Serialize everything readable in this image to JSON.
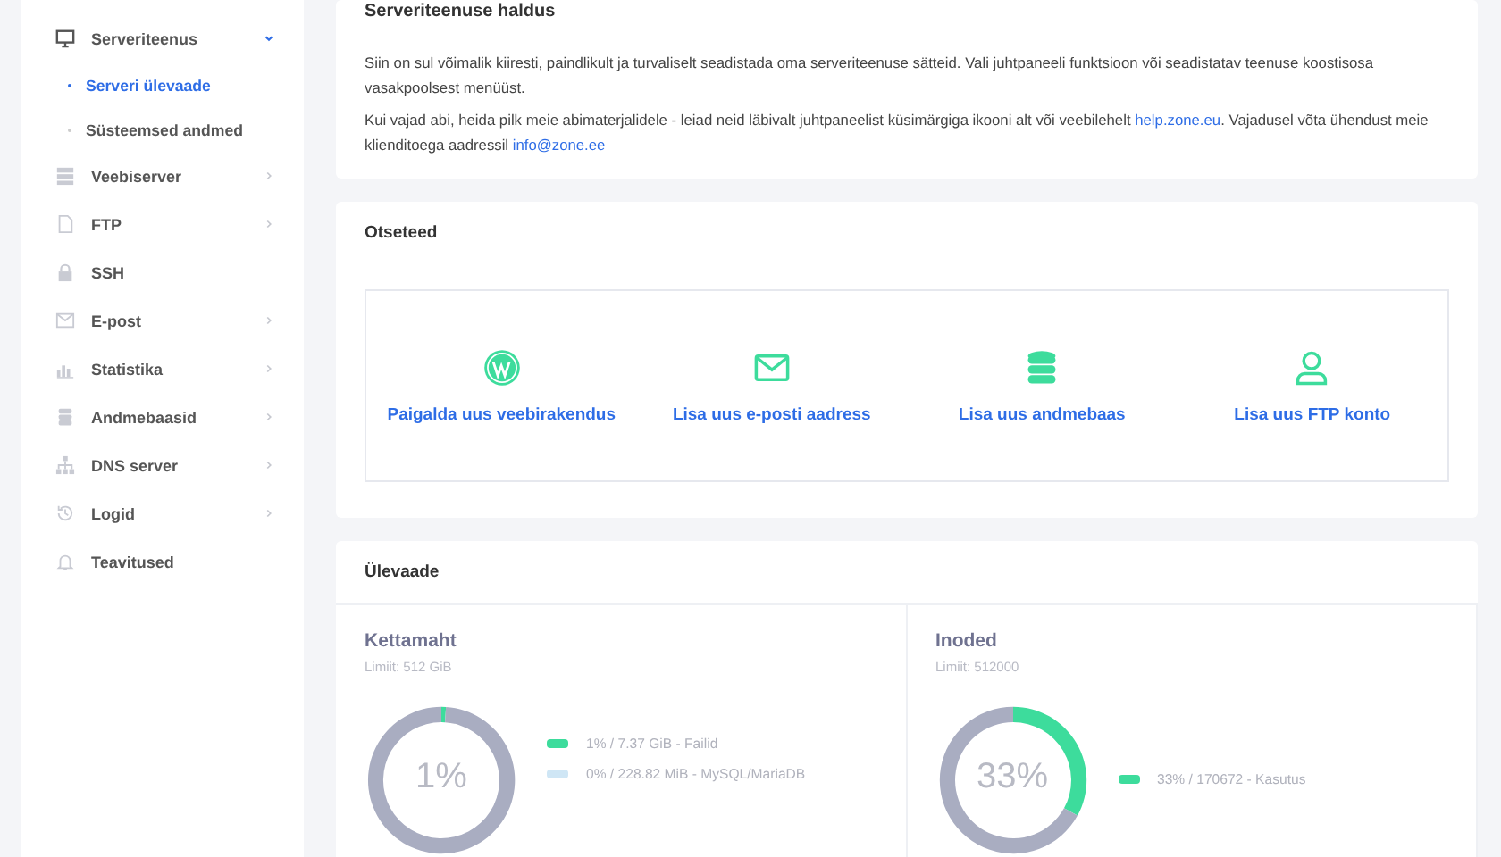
{
  "sidebar": {
    "items": [
      {
        "label": "Serveriteenus",
        "expanded": true,
        "children": [
          {
            "label": "Serveri ülevaade",
            "selected": true
          },
          {
            "label": "Süsteemsed andmed",
            "selected": false
          }
        ]
      },
      {
        "label": "Veebiserver",
        "expanded": false
      },
      {
        "label": "FTP",
        "expanded": false
      },
      {
        "label": "SSH"
      },
      {
        "label": "E-post",
        "expanded": false
      },
      {
        "label": "Statistika",
        "expanded": false
      },
      {
        "label": "Andmebaasid",
        "expanded": false
      },
      {
        "label": "DNS server",
        "expanded": false
      },
      {
        "label": "Logid",
        "expanded": false
      },
      {
        "label": "Teavitused"
      }
    ]
  },
  "intro": {
    "title": "Serveriteenuse haldus",
    "paragraphs": [
      "Siin on sul võimalik kiiresti, paindlikult ja turvaliselt seadistada oma serveriteenuse sätteid. Vali juhtpaneeli funktsioon või seadistatav teenuse koostisosa vasakpoolsest menüüst.",
      "Kui vajad abi, heida pilk meie abimaterjalidele - leiad neid läbivalt juhtpaneelist küsimärgiga ikooni alt või veebilehelt"
    ],
    "help_link": "help.zone.eu",
    "after_link": ". Vajadusel võta ühendust meie klienditoega aadressil",
    "email_link": "info@zone.ee"
  },
  "shortcuts": {
    "title": "Otseteed",
    "items": [
      {
        "label": "Paigalda uus veebirakendus"
      },
      {
        "label": "Lisa uus e-posti aadress"
      },
      {
        "label": "Lisa uus andmebaas"
      },
      {
        "label": "Lisa uus FTP konto"
      }
    ]
  },
  "overview": {
    "title": "Ülevaade",
    "cards": [
      {
        "title": "Kettamaht",
        "limit": "Limiit: 512 GiB",
        "percent": "1%",
        "chart_data": {
          "type": "donut",
          "values": [
            1,
            99
          ]
        },
        "legend": [
          {
            "text": "1% / 7.37 GiB - Failid",
            "color": "#3ddc9c"
          },
          {
            "text": "0% / 228.82 MiB - MySQL/MariaDB",
            "color": "#cfe6f5"
          }
        ]
      },
      {
        "title": "Inoded",
        "limit": "Limiit: 512000",
        "percent": "33%",
        "chart_data": {
          "type": "donut",
          "values": [
            33,
            67
          ]
        },
        "legend": [
          {
            "text": "33% / 170672 - Kasutus",
            "color": "#3ddc9c"
          }
        ]
      }
    ]
  }
}
